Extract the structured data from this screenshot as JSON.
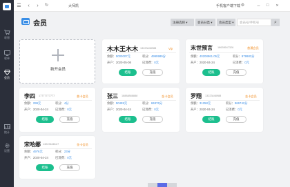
{
  "topbar": {
    "title": "大师凯",
    "download_link": "手机客户端下载"
  },
  "sidebar": {
    "items": [
      {
        "label": "收银",
        "icon": "cart-icon"
      },
      {
        "label": "收单",
        "icon": "monitor-icon"
      },
      {
        "label": "会员",
        "icon": "diamond-icon"
      },
      {
        "label": "统计",
        "icon": "chart-icon"
      },
      {
        "label": "设置",
        "icon": "gear-icon"
      }
    ]
  },
  "header": {
    "page_title": "会员",
    "filters": [
      "注册选择",
      "会员分类",
      "会员类型"
    ],
    "search_placeholder": "会员号/手机号"
  },
  "add_card": {
    "label": "新开会员"
  },
  "common": {
    "balance_label": "余额：",
    "points_label": "积分：",
    "open_date_label": "开户：",
    "consumed_label": "已消费：",
    "settle_label": "结账",
    "recharge_label": "充值"
  },
  "members": [
    {
      "name": "木木王木木",
      "phone": "13223448988",
      "level": "Vip",
      "balance": "5000007元",
      "points": "4999989分",
      "date": "2020-05-08",
      "consumed": "0元"
    },
    {
      "name": "末世预言",
      "phone": "18639547326",
      "level": "普通会员",
      "balance": "40208961.05元",
      "points": "979983分",
      "date": "2020-04-24",
      "consumed": "0元"
    },
    {
      "name": "李四",
      "phone": "17777777777",
      "level": "普卡会员",
      "balance": "299元",
      "points": "4分",
      "date": "2020-04-24",
      "consumed": "0元"
    },
    {
      "name": "张三",
      "phone": "18888888888",
      "level": "金卡会员",
      "balance": "50499元",
      "points": "84876分",
      "date": "2020-04-24",
      "consumed": "0元"
    },
    {
      "name": "罗翔",
      "phone": "13223448988",
      "level": "金卡会员",
      "balance": "31258元",
      "points": "966742分",
      "date": "2020-04-24",
      "consumed": "0元"
    },
    {
      "name": "宋哈娜",
      "phone": "13223448127",
      "level": "金卡会员",
      "balance": "4976元",
      "points": "23分",
      "date": "2020-04-24",
      "consumed": "0元"
    }
  ],
  "colors": {
    "sidebar_bg": "#2b2f3a",
    "accent_blue": "#3a8ee6",
    "settle_green": "#1cbf8e",
    "level_orange": "#f08a1c",
    "pager_active": "#5b6be6"
  }
}
